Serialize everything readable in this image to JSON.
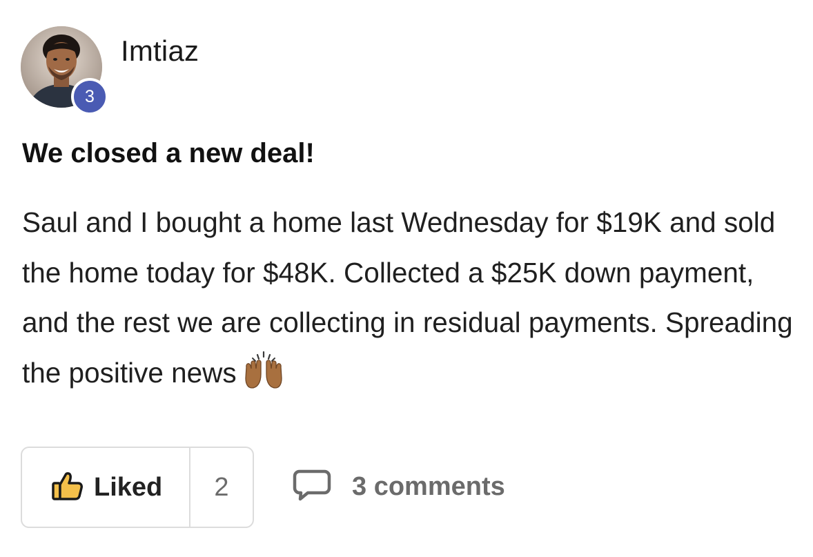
{
  "author": {
    "name": "Imtiaz",
    "level": "3"
  },
  "post": {
    "title": "We closed a new deal!",
    "body": "Saul and I bought a home last Wednesday for $19K and sold the home today for $48K. Collected a $25K down payment, and the rest we are collecting in residual payments. Spreading the positive news",
    "emoji": "raising-hands-emoji"
  },
  "actions": {
    "like_label": "Liked",
    "like_count": "2",
    "comments_label": "3 comments"
  },
  "colors": {
    "badge": "#4a5bb3",
    "muted_text": "#6b6b6b",
    "border": "#dcdcdc",
    "thumb_fill": "#f4c04a"
  }
}
